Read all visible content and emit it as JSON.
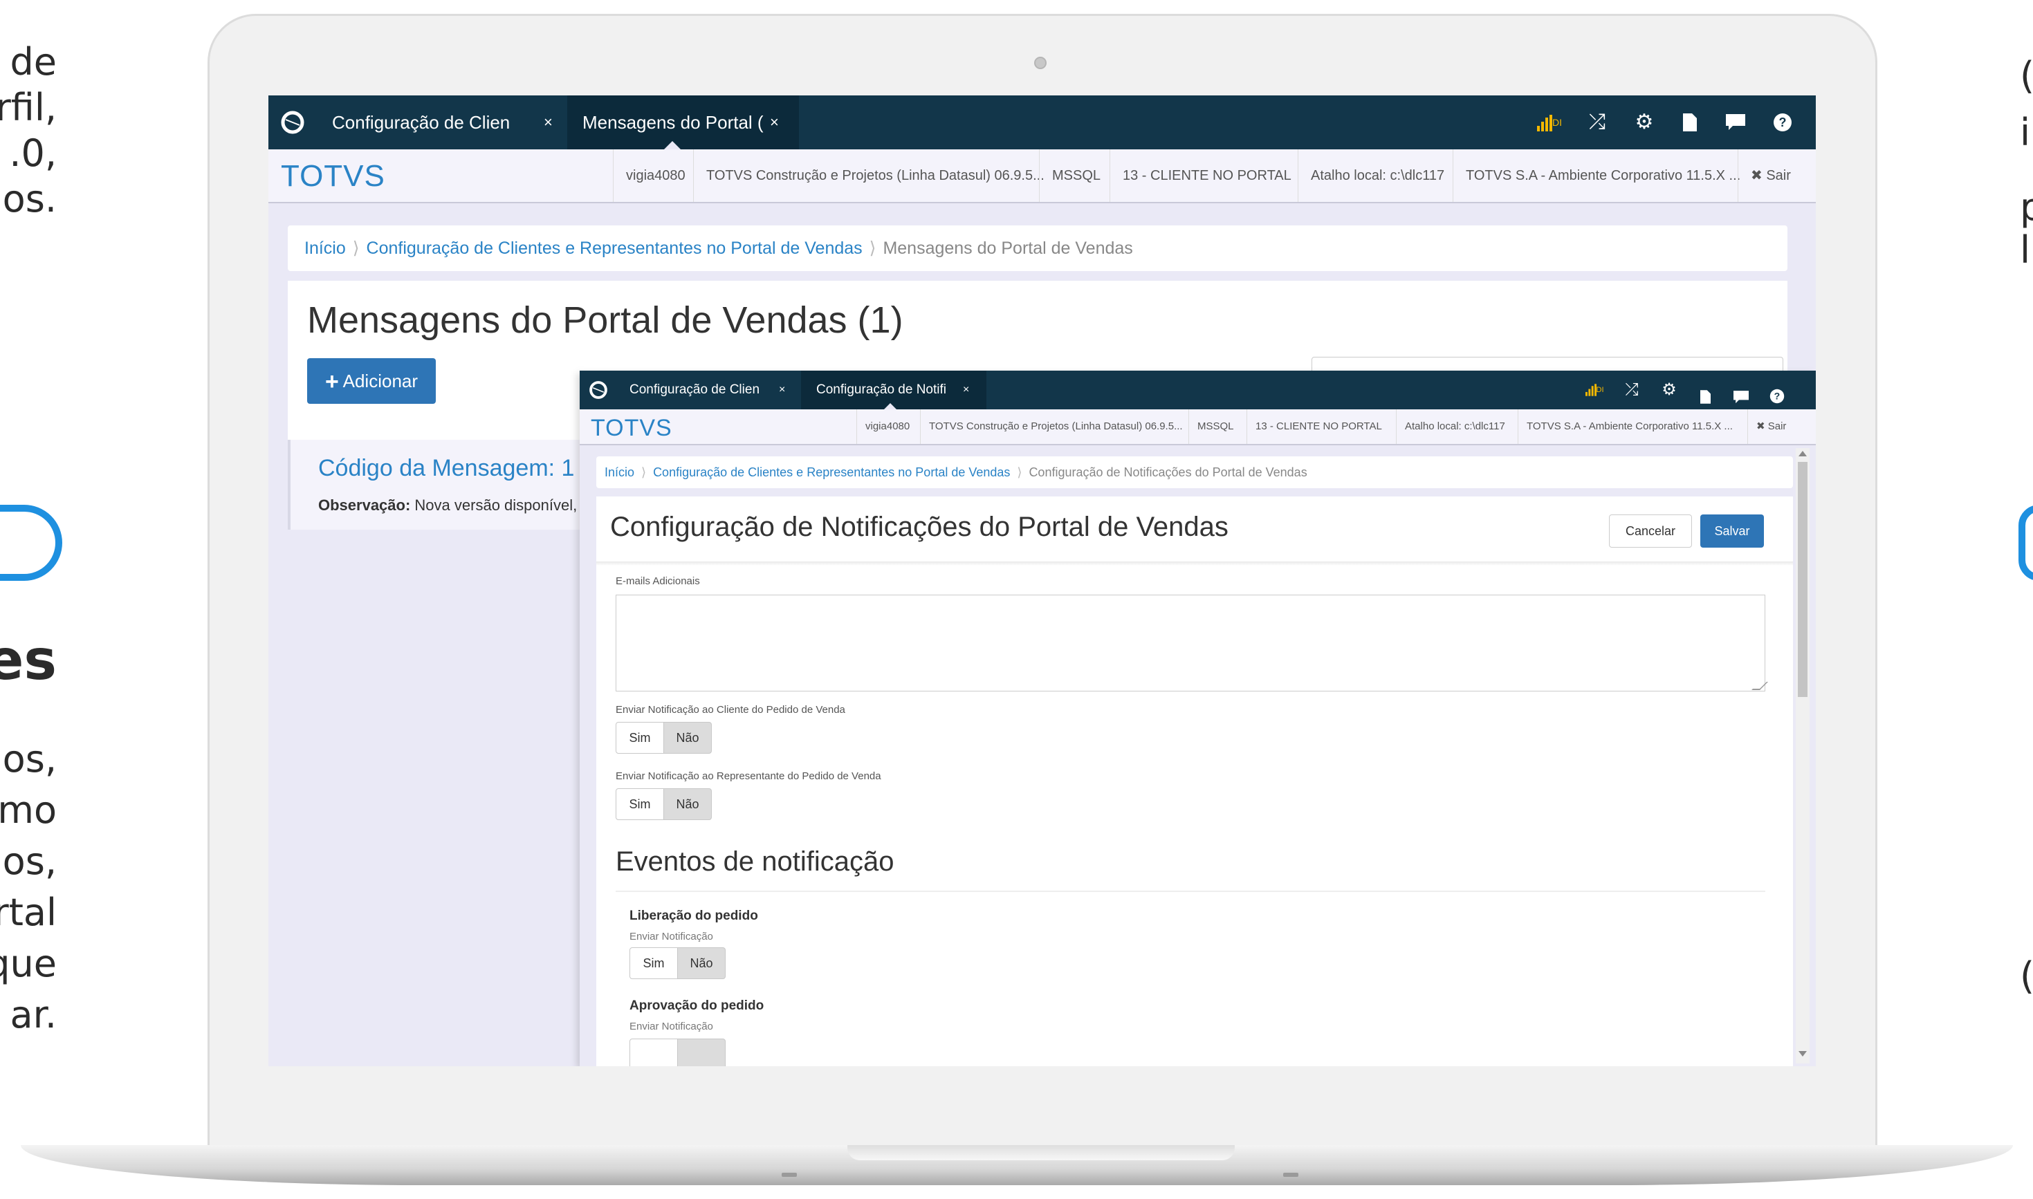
{
  "side_left": [
    "de",
    "rfil,",
    ".0,",
    "os.",
    "es",
    "os,",
    "mo",
    "os,",
    "rtal",
    "que",
    "ar."
  ],
  "side_right": [
    "(",
    "i",
    "p",
    "l",
    "("
  ],
  "back_window": {
    "tabs": [
      {
        "label": "Configuração de Clien",
        "close": "×"
      },
      {
        "label": "Mensagens do Portal (",
        "close": "×"
      }
    ],
    "toolbar_icons": [
      "signal-icon",
      "shuffle-icon",
      "gear-icon",
      "file-icon",
      "comment-icon",
      "help-icon"
    ],
    "signal_text": "DI",
    "brand": "TOTVS",
    "info": [
      "vigia4080",
      "TOTVS Construção e Projetos (Linha Datasul) 06.9.5...",
      "MSSQL",
      "13 - CLIENTE NO PORTAL",
      "Atalho local: c:\\dlc117",
      "TOTVS S.A - Ambiente Corporativo 11.5.X ..."
    ],
    "logout": "✖ Sair",
    "breadcrumb": [
      "Início",
      "Configuração de Clientes e Representantes no Portal de Vendas",
      "Mensagens do Portal de Vendas"
    ],
    "page_title": "Mensagens do Portal de Vendas (1)",
    "add_button": "Adicionar",
    "message_code": "Código da Mensagem: 1",
    "observation_label": "Observação:",
    "observation_text": "Nova versão disponível, p"
  },
  "front_window": {
    "tabs": [
      {
        "label": "Configuração de Clien",
        "close": "×"
      },
      {
        "label": "Configuração de Notifi",
        "close": "×"
      }
    ],
    "signal_text": "DI",
    "brand": "TOTVS",
    "info": [
      "vigia4080",
      "TOTVS Construção e Projetos (Linha Datasul) 06.9.5...",
      "MSSQL",
      "13 - CLIENTE NO PORTAL",
      "Atalho local: c:\\dlc117",
      "TOTVS S.A - Ambiente Corporativo 11.5.X ..."
    ],
    "logout": "✖ Sair",
    "breadcrumb": [
      "Início",
      "Configuração de Clientes e Representantes no Portal de Vendas",
      "Configuração de Notificações do Portal de Vendas"
    ],
    "page_title": "Configuração de Notificações do Portal de Vendas",
    "cancel": "Cancelar",
    "save": "Salvar",
    "emails_label": "E-mails Adicionais",
    "emails_value": "",
    "notify_client_label": "Enviar Notificação ao Cliente do Pedido de Venda",
    "notify_rep_label": "Enviar Notificação ao Representante do Pedido de Venda",
    "yes": "Sim",
    "no": "Não",
    "events_title": "Eventos de notificação",
    "event1_title": "Liberação do pedido",
    "event1_sub": "Enviar Notificação",
    "event2_title": "Aprovação do pedido",
    "event2_sub": "Enviar Notificação"
  }
}
